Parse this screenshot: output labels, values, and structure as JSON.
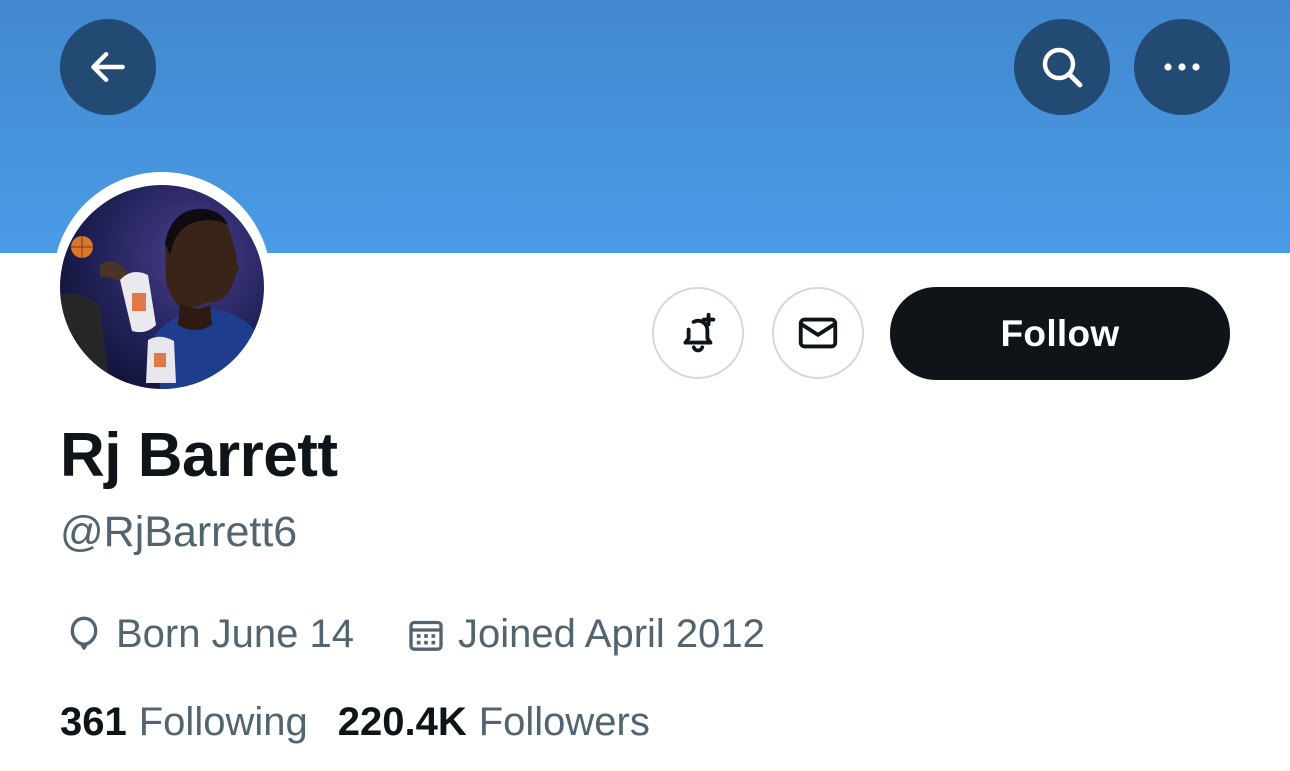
{
  "profile": {
    "name": "Rj Barrett",
    "handle": "@RjBarrett6",
    "birthday": "Born June 14",
    "joined": "Joined April 2012"
  },
  "stats": {
    "following_count": "361",
    "following_label": "Following",
    "followers_count": "220.4K",
    "followers_label": "Followers"
  },
  "actions": {
    "follow_label": "Follow"
  },
  "icons": {
    "back": "arrow-left-icon",
    "search": "search-icon",
    "more": "more-horizontal-icon",
    "notify": "bell-plus-icon",
    "message": "envelope-icon",
    "birthday": "balloon-icon",
    "joined": "calendar-icon"
  },
  "colors": {
    "banner": "#4a9be6",
    "header_button": "#224a72",
    "follow_button": "#0f1419",
    "secondary_text": "#536471"
  }
}
